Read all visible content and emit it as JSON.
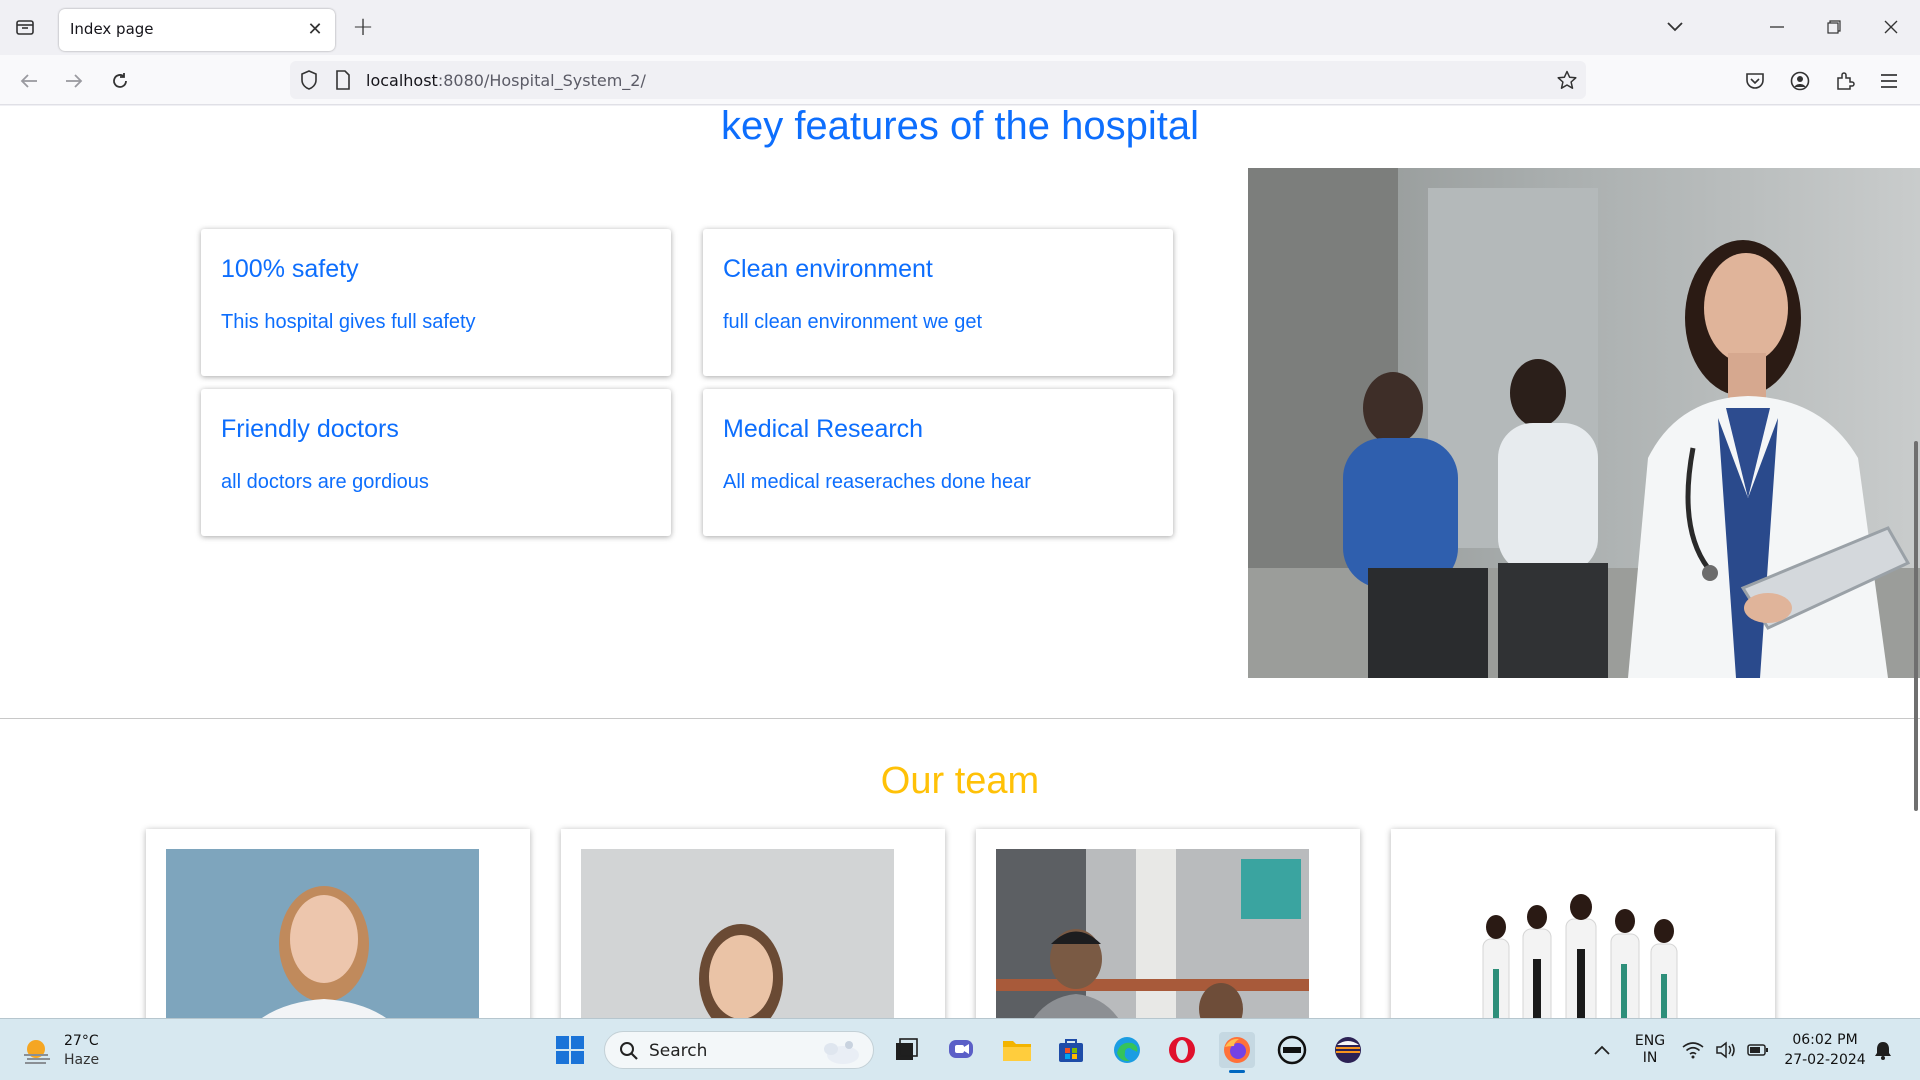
{
  "browser": {
    "tab_title": "Index page",
    "url_host": "localhost",
    "url_rest": ":8080/Hospital_System_2/",
    "icons": [
      "tab-list-icon",
      "close-icon",
      "plus-icon",
      "chevron-down-icon",
      "minimize-icon",
      "restore-icon",
      "window-close-icon",
      "back-icon",
      "forward-icon",
      "reload-icon",
      "shield-icon",
      "page-icon",
      "star-icon",
      "pocket-icon",
      "account-icon",
      "extensions-icon",
      "menu-icon"
    ]
  },
  "page": {
    "features_title": "key features of the hospital",
    "features": [
      {
        "title": "100% safety",
        "text": "This hospital gives full safety"
      },
      {
        "title": "Clean environment",
        "text": "full clean environment we get"
      },
      {
        "title": "Friendly doctors",
        "text": "all doctors are gordious"
      },
      {
        "title": "Medical Research",
        "text": "All medical reaseraches done hear"
      }
    ],
    "team_title": "Our team",
    "colors": {
      "primary": "#0d6efd",
      "team_title": "#ffc107"
    }
  },
  "taskbar": {
    "weather_temp": "27°C",
    "weather_cond": "Haze",
    "search_label": "Search",
    "lang_line1": "ENG",
    "lang_line2": "IN",
    "time": "06:02 PM",
    "date": "27-02-2024"
  }
}
